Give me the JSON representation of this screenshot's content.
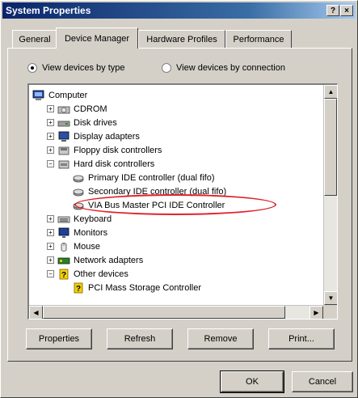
{
  "window": {
    "title": "System Properties",
    "help_label": "?",
    "close_label": "×"
  },
  "tabs": [
    {
      "label": "General"
    },
    {
      "label": "Device Manager"
    },
    {
      "label": "Hardware Profiles"
    },
    {
      "label": "Performance"
    }
  ],
  "view_options": {
    "by_type": "View devices by type",
    "by_connection": "View devices by connection",
    "selected": "by_type"
  },
  "tree": [
    {
      "label": "Computer",
      "level": 0,
      "expander": "",
      "icon": "computer-icon"
    },
    {
      "label": "CDROM",
      "level": 1,
      "expander": "+",
      "icon": "cdrom-icon"
    },
    {
      "label": "Disk drives",
      "level": 1,
      "expander": "+",
      "icon": "disk-drive-icon"
    },
    {
      "label": "Display adapters",
      "level": 1,
      "expander": "+",
      "icon": "display-adapter-icon"
    },
    {
      "label": "Floppy disk controllers",
      "level": 1,
      "expander": "+",
      "icon": "floppy-controller-icon"
    },
    {
      "label": "Hard disk controllers",
      "level": 1,
      "expander": "−",
      "icon": "hard-disk-controller-icon"
    },
    {
      "label": "Primary IDE controller (dual fifo)",
      "level": 2,
      "expander": "",
      "icon": "ide-controller-icon"
    },
    {
      "label": "Secondary IDE controller (dual fifo)",
      "level": 2,
      "expander": "",
      "icon": "ide-controller-icon"
    },
    {
      "label": "VIA Bus Master PCI IDE Controller",
      "level": 2,
      "expander": "",
      "icon": "ide-controller-icon",
      "highlighted": true
    },
    {
      "label": "Keyboard",
      "level": 1,
      "expander": "+",
      "icon": "keyboard-icon"
    },
    {
      "label": "Monitors",
      "level": 1,
      "expander": "+",
      "icon": "monitor-icon"
    },
    {
      "label": "Mouse",
      "level": 1,
      "expander": "+",
      "icon": "mouse-icon"
    },
    {
      "label": "Network adapters",
      "level": 1,
      "expander": "+",
      "icon": "network-adapter-icon"
    },
    {
      "label": "Other devices",
      "level": 1,
      "expander": "−",
      "icon": "unknown-device-icon"
    },
    {
      "label": "PCI Mass Storage Controller",
      "level": 2,
      "expander": "",
      "icon": "unknown-device-icon"
    }
  ],
  "buttons": {
    "properties": "Properties",
    "refresh": "Refresh",
    "remove": "Remove",
    "print": "Print...",
    "ok": "OK",
    "cancel": "Cancel"
  },
  "colors": {
    "highlight_ring": "#e0202a",
    "title_bar": "#0a246a"
  }
}
